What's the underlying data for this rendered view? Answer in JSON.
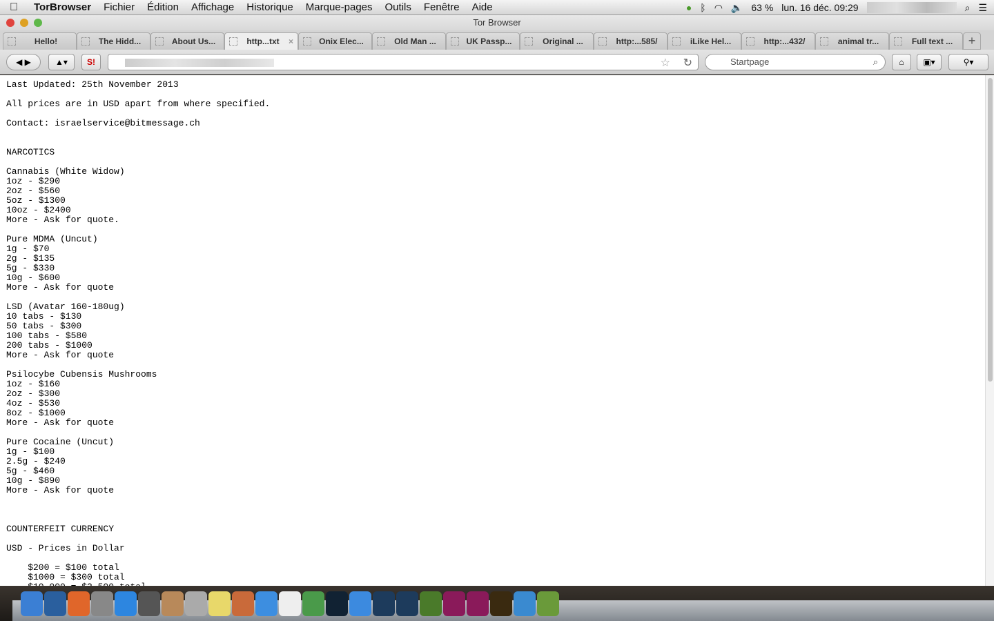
{
  "menubar": {
    "app": "TorBrowser",
    "items": [
      "Fichier",
      "Édition",
      "Affichage",
      "Historique",
      "Marque-pages",
      "Outils",
      "Fenêtre",
      "Aide"
    ],
    "battery": "63 %",
    "clock": "lun. 16 déc.  09:29"
  },
  "window": {
    "title": "Tor Browser"
  },
  "tabs": [
    {
      "label": "Hello!"
    },
    {
      "label": "The Hidd..."
    },
    {
      "label": "About Us..."
    },
    {
      "label": "http...txt",
      "active": true
    },
    {
      "label": "Onix Elec..."
    },
    {
      "label": "Old Man ..."
    },
    {
      "label": "UK Passp..."
    },
    {
      "label": "Original ..."
    },
    {
      "label": "http:...585/"
    },
    {
      "label": "iLike Hel..."
    },
    {
      "label": "http:...432/"
    },
    {
      "label": "animal tr..."
    },
    {
      "label": "Full text ..."
    }
  ],
  "newtab": "+",
  "search": {
    "placeholder": "Startpage"
  },
  "page": {
    "text": "Last Updated: 25th November 2013\n\nAll prices are in USD apart from where specified.\n\nContact: israelservice@bitmessage.ch\n\n\nNARCOTICS\n\nCannabis (White Widow)\n1oz - $290\n2oz - $560\n5oz - $1300\n10oz - $2400\nMore - Ask for quote.\n\nPure MDMA (Uncut)\n1g - $70\n2g - $135\n5g - $330\n10g - $600\nMore - Ask for quote\n\nLSD (Avatar 160-180ug)\n10 tabs - $130\n50 tabs - $300\n100 tabs - $580\n200 tabs - $1000\nMore - Ask for quote\n\nPsilocybe Cubensis Mushrooms\n1oz - $160\n2oz - $300\n4oz - $530\n8oz - $1000\nMore - Ask for quote\n\nPure Cocaine (Uncut)\n1g - $100\n2.5g - $240\n5g - $460\n10g - $890\nMore - Ask for quote\n\n\n\nCOUNTERFEIT CURRENCY\n\nUSD - Prices in Dollar\n\n    $200 = $100 total\n    $1000 = $300 total\n    $10,000 = $2,500 total"
  },
  "dock": [
    {
      "name": "Finder",
      "color": "#3b7fd4"
    },
    {
      "name": "Thunderbird",
      "color": "#2a5f9e"
    },
    {
      "name": "Firefox",
      "color": "#e0662a"
    },
    {
      "name": "Launchpad",
      "color": "#888"
    },
    {
      "name": "App Store",
      "color": "#2d86e0"
    },
    {
      "name": "Photo",
      "color": "#555"
    },
    {
      "name": "Contacts",
      "color": "#b8895a"
    },
    {
      "name": "Help",
      "color": "#aaa"
    },
    {
      "name": "Notes",
      "color": "#e8d86a"
    },
    {
      "name": "Keynote",
      "color": "#c96a3a"
    },
    {
      "name": "Dropbox",
      "color": "#3d8ee0"
    },
    {
      "name": "Calendar",
      "color": "#eee"
    },
    {
      "name": "Numbers",
      "color": "#4a9a4a"
    },
    {
      "name": "P",
      "color": "#123"
    },
    {
      "name": "iTunes",
      "color": "#3c8adf"
    },
    {
      "name": "Ps",
      "color": "#1d3b5c"
    },
    {
      "name": "Ps",
      "color": "#1d3b5c"
    },
    {
      "name": "Dw",
      "color": "#4a7a2a"
    },
    {
      "name": "ID",
      "color": "#8a1a5a"
    },
    {
      "name": "Id",
      "color": "#8a1a5a"
    },
    {
      "name": "Ai",
      "color": "#3a2a10"
    },
    {
      "name": "Safari",
      "color": "#3a8ad0"
    },
    {
      "name": "Tor",
      "color": "#6a9a3a"
    }
  ]
}
